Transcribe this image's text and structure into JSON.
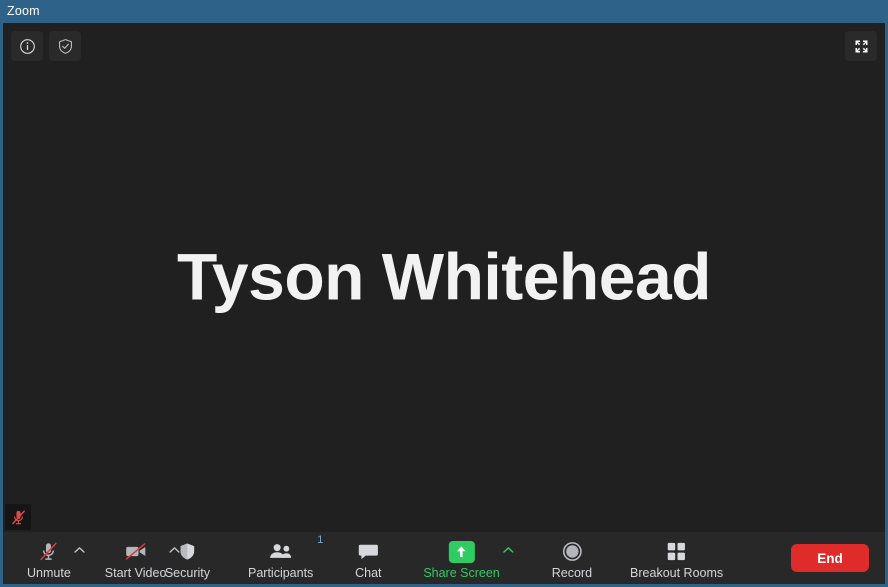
{
  "window": {
    "title": "Zoom",
    "titlebar_color": "#2e6289",
    "stage_color": "#202020",
    "toolbar_color": "#282828"
  },
  "stage": {
    "participant_name": "Tyson Whitehead",
    "info_button": {
      "icon": "info-circle-icon",
      "label": "Meeting Information"
    },
    "security_button": {
      "icon": "shield-check-icon",
      "label": "Encryption Status"
    },
    "fullscreen_button": {
      "icon": "fullscreen-expand-icon",
      "label": "Enter Full Screen"
    },
    "mute_badge": {
      "icon": "microphone-muted-icon",
      "label": "Muted"
    }
  },
  "toolbar": {
    "audio": {
      "label": "Unmute",
      "icon": "microphone-muted-icon",
      "chevron": "chevron-up-icon"
    },
    "video": {
      "label": "Start Video",
      "icon": "camera-off-icon",
      "chevron": "chevron-up-icon"
    },
    "security": {
      "label": "Security",
      "icon": "shield-icon"
    },
    "participants": {
      "label": "Participants",
      "icon": "people-icon",
      "count": "1"
    },
    "chat": {
      "label": "Chat",
      "icon": "chat-bubble-icon"
    },
    "share_screen": {
      "label": "Share Screen",
      "icon": "share-arrow-up-icon",
      "chevron": "chevron-up-icon",
      "accent_color": "#2ecc63"
    },
    "record": {
      "label": "Record",
      "icon": "record-circle-icon"
    },
    "breakout_rooms": {
      "label": "Breakout Rooms",
      "icon": "grid-squares-icon"
    },
    "end": {
      "label": "End",
      "color": "#e02b2b"
    }
  }
}
